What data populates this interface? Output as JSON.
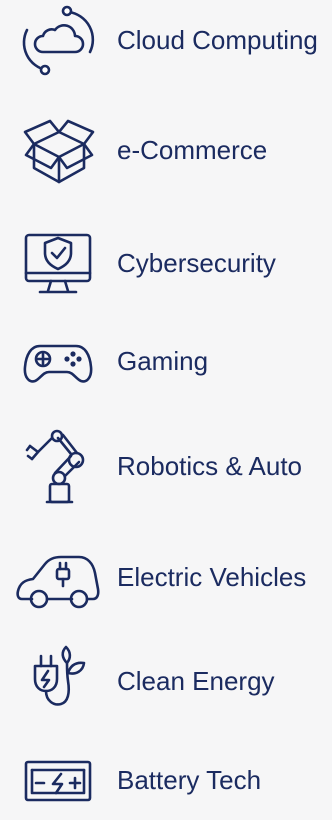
{
  "categories": [
    {
      "label": "Cloud Computing",
      "icon": "cloud-sync-icon"
    },
    {
      "label": "e-Commerce",
      "icon": "open-box-icon"
    },
    {
      "label": "Cybersecurity",
      "icon": "shield-monitor-icon"
    },
    {
      "label": "Gaming",
      "icon": "gamepad-icon"
    },
    {
      "label": "Robotics & Auto",
      "icon": "robot-arm-icon"
    },
    {
      "label": "Electric Vehicles",
      "icon": "electric-car-icon"
    },
    {
      "label": "Clean Energy",
      "icon": "plug-leaf-icon"
    },
    {
      "label": "Battery Tech",
      "icon": "battery-icon"
    }
  ],
  "colors": {
    "background": "#f6f6f7",
    "primary": "#1b2b60"
  }
}
